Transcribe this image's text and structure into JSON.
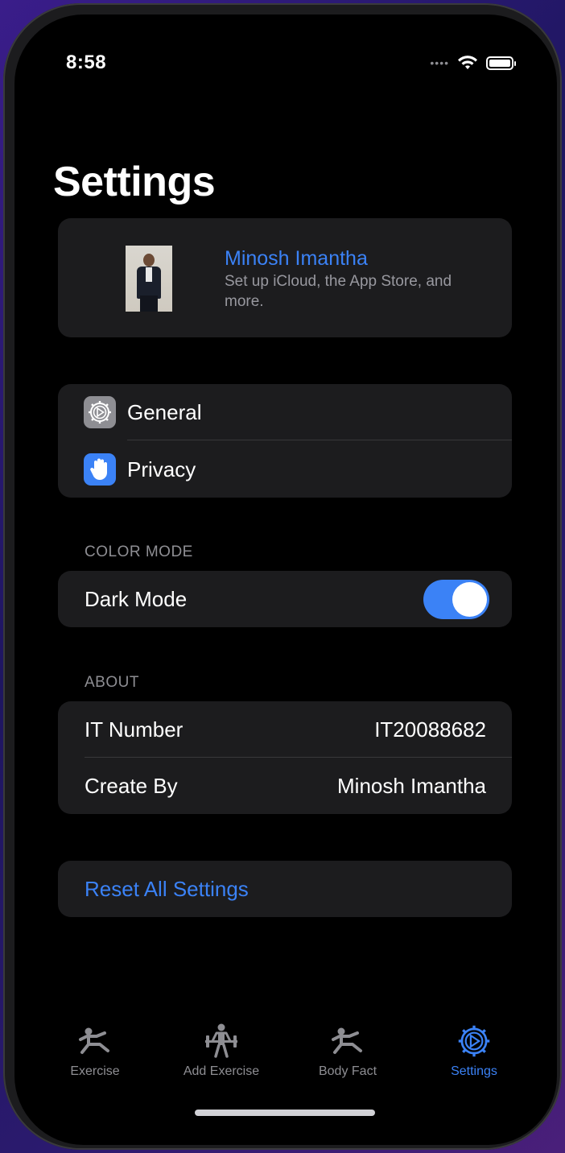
{
  "status_bar": {
    "time": "8:58"
  },
  "page": {
    "title": "Settings"
  },
  "profile": {
    "name": "Minosh Imantha",
    "subtitle": "Set up iCloud, the App Store, and more."
  },
  "settings_group": {
    "items": [
      {
        "label": "General",
        "icon": "gear-icon",
        "icon_color": "#8e8e93"
      },
      {
        "label": "Privacy",
        "icon": "hand-raised-icon",
        "icon_color": "#3b82f6"
      }
    ]
  },
  "color_mode": {
    "header": "COLOR MODE",
    "dark_mode_label": "Dark Mode",
    "dark_mode_enabled": true
  },
  "about": {
    "header": "ABOUT",
    "rows": [
      {
        "label": "IT Number",
        "value": "IT20088682"
      },
      {
        "label": "Create By",
        "value": "Minosh Imantha"
      }
    ]
  },
  "reset": {
    "label": "Reset All Settings"
  },
  "tab_bar": {
    "tabs": [
      {
        "label": "Exercise",
        "icon": "stretching-figure-icon",
        "active": false
      },
      {
        "label": "Add Exercise",
        "icon": "weightlifter-icon",
        "active": false
      },
      {
        "label": "Body Fact",
        "icon": "stretching-figure-icon",
        "active": false
      },
      {
        "label": "Settings",
        "icon": "gear-icon",
        "active": true
      }
    ]
  },
  "colors": {
    "accent": "#3b82f6",
    "card": "#1c1c1e",
    "background": "#000000"
  }
}
